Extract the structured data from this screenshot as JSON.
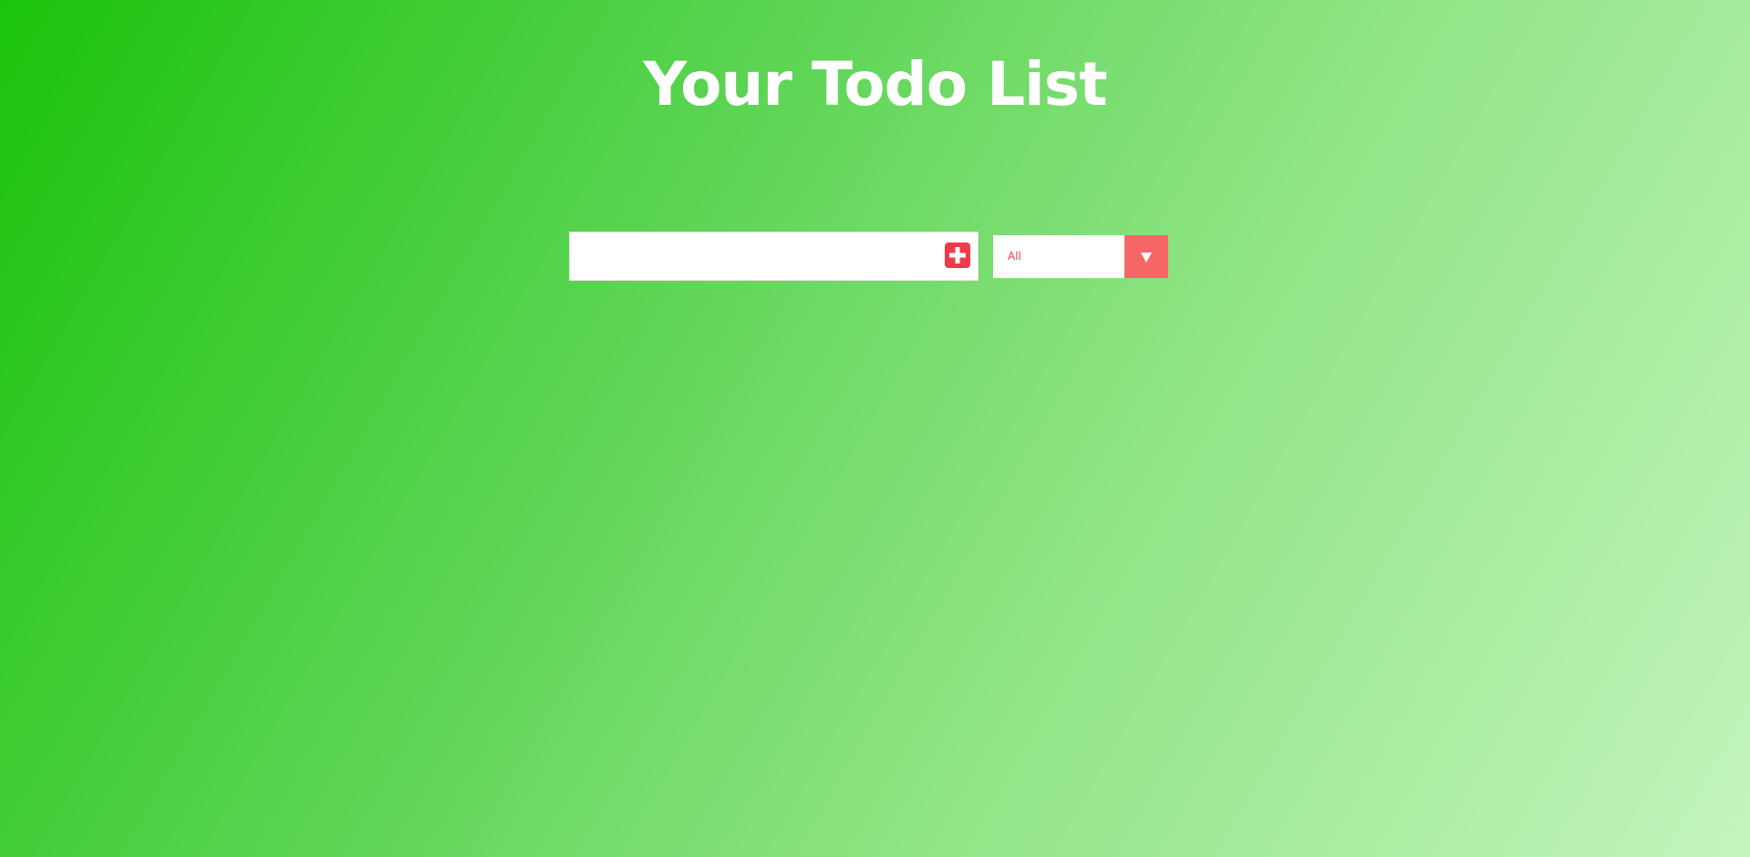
{
  "page": {
    "title": "Your Todo List"
  },
  "todo_form": {
    "input_value": "",
    "input_placeholder": "",
    "add_icon": "plus-square-icon"
  },
  "filter": {
    "selected": "All",
    "arrow_icon": "triangle-down-icon"
  },
  "colors": {
    "accent": "#ee3b49",
    "arrow_bg": "#f76666",
    "bg_gradient_start": "#1bc30c",
    "bg_gradient_end": "#c4f5bd"
  }
}
